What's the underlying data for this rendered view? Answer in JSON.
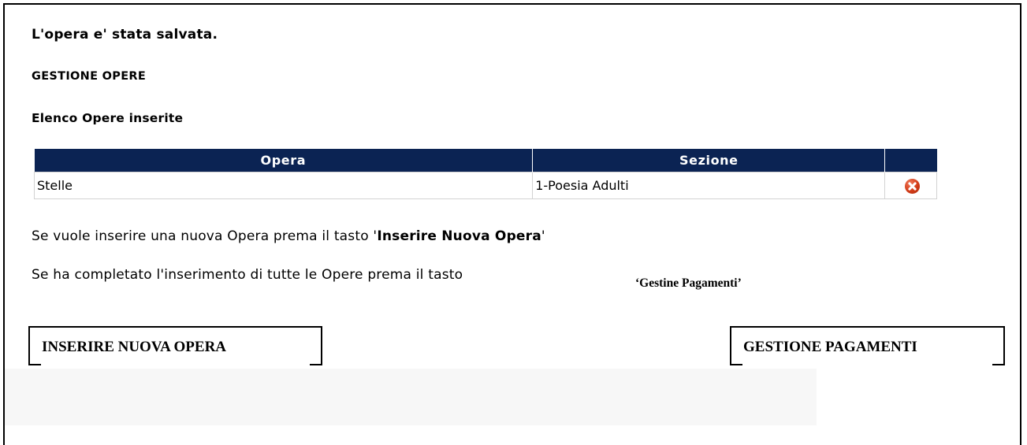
{
  "messages": {
    "saved": "L'opera e' stata salvata.",
    "section_title": "GESTIONE OPERE",
    "list_title": "Elenco Opere inserite"
  },
  "table": {
    "headers": [
      "Opera",
      "Sezione",
      ""
    ],
    "rows": [
      {
        "opera": "Stelle",
        "sezione": "1-Poesia Adulti",
        "action_icon": "delete-icon"
      }
    ]
  },
  "instructions": {
    "line1_prefix": "Se vuole inserire una nuova Opera prema il tasto '",
    "line1_bold": "Inserire Nuova Opera",
    "line1_suffix": "'",
    "line2": "Se ha completato l'inserimento di tutte le Opere prema il tasto",
    "line2_label": "‘Gestine Pagamenti’"
  },
  "buttons": {
    "inserire": "INSERIRE NUOVA OPERA",
    "gestione": "GESTIONE PAGAMENTI"
  },
  "colors": {
    "header_bg": "#0b2353",
    "delete_icon": "#d23b17"
  }
}
